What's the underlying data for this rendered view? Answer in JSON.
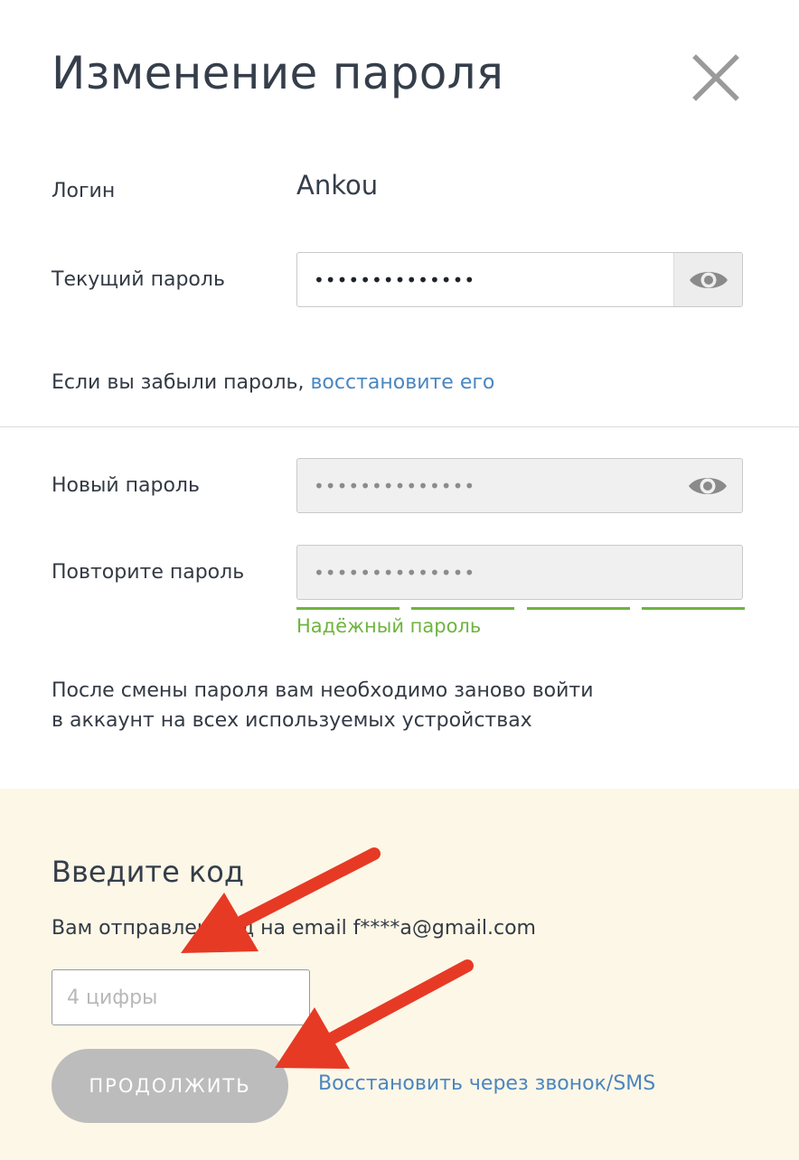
{
  "dialog": {
    "title": "Изменение пароля",
    "close_icon": "close-icon"
  },
  "login": {
    "label": "Логин",
    "value": "Ankou"
  },
  "current_password": {
    "label": "Текущий пароль",
    "masked_value": "••••••••••••••",
    "toggle_icon": "eye-icon"
  },
  "forgot": {
    "text": "Если вы забыли пароль,",
    "link": "восстановите его"
  },
  "new_password": {
    "label": "Новый пароль",
    "masked_value": "••••••••••••••",
    "toggle_icon": "eye-icon"
  },
  "repeat_password": {
    "label": "Повторите пароль",
    "masked_value": "••••••••••••••"
  },
  "strength": {
    "label": "Надёжный пароль",
    "level": 4,
    "max_level": 4,
    "color": "#6fb43f"
  },
  "notice": {
    "line1": "После смены пароля вам необходимо заново войти",
    "line2": "в аккаунт на всех используемых устройствах"
  },
  "code": {
    "title": "Введите код",
    "description": "Вам отправлен код на email f****a@gmail.com",
    "placeholder": "4 цифры",
    "continue_label": "ПРОДОЛЖИТЬ",
    "recover_link": "Восстановить через звонок/SMS"
  },
  "colors": {
    "link": "#4a86c0",
    "panel_bg": "#fdf7e7",
    "button_disabled": "#bcbcbc",
    "annotation_arrow": "#e63a25"
  }
}
